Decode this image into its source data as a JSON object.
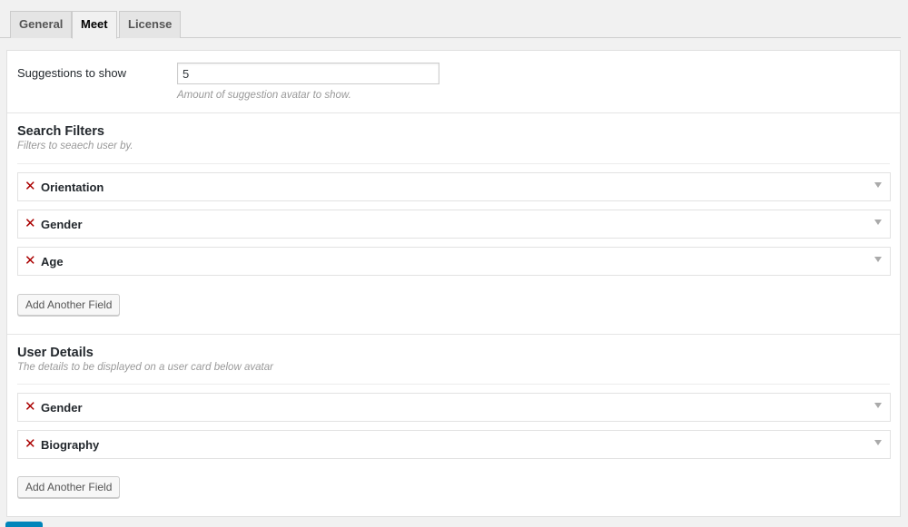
{
  "tabs": [
    {
      "label": "General",
      "active": false
    },
    {
      "label": "Meet",
      "active": true
    },
    {
      "label": "License",
      "active": false
    }
  ],
  "suggestions": {
    "label": "Suggestions to show",
    "value": "5",
    "description": "Amount of suggestion avatar to show."
  },
  "search_filters": {
    "title": "Search Filters",
    "description": "Filters to seaech user by.",
    "fields": [
      "Orientation",
      "Gender",
      "Age"
    ],
    "add_label": "Add Another Field"
  },
  "user_details": {
    "title": "User Details",
    "description": "The details to be displayed on a user card below avatar",
    "fields": [
      "Gender",
      "Biography"
    ],
    "add_label": "Add Another Field"
  },
  "icons": {
    "remove": "close-icon",
    "toggle": "chevron-down-icon"
  },
  "colors": {
    "remove": "#aa0000",
    "primary": "#0085ba"
  }
}
